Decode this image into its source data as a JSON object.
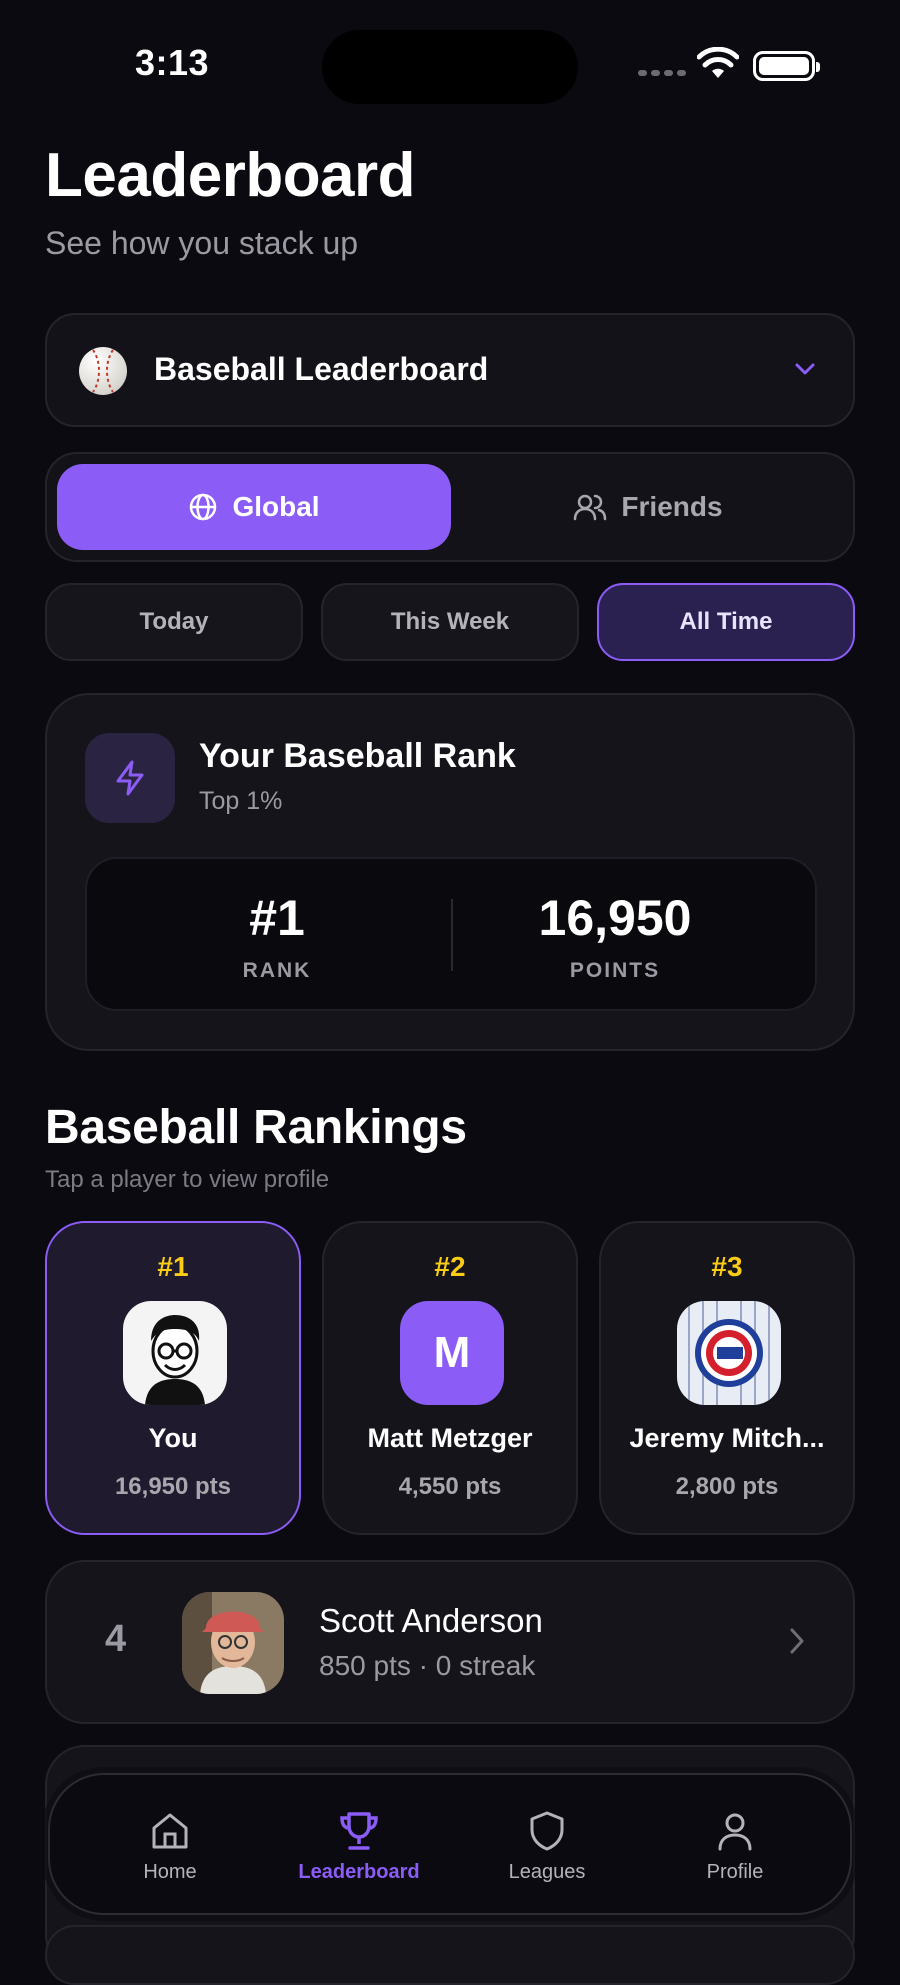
{
  "status_bar": {
    "time": "3:13"
  },
  "header": {
    "title": "Leaderboard",
    "subtitle": "See how you stack up"
  },
  "selector": {
    "label": "Baseball Leaderboard"
  },
  "scope": {
    "global": "Global",
    "friends": "Friends",
    "selected": "Global"
  },
  "periods": {
    "today": "Today",
    "week": "This Week",
    "all": "All Time",
    "selected": "All Time"
  },
  "rank_card": {
    "title": "Your Baseball Rank",
    "subtitle": "Top 1%",
    "rank_value": "#1",
    "rank_label": "RANK",
    "points_value": "16,950",
    "points_label": "POINTS"
  },
  "rankings": {
    "title": "Baseball Rankings",
    "subtitle": "Tap a player to view profile",
    "podium": [
      {
        "rank": "#1",
        "name": "You",
        "points": "16,950 pts"
      },
      {
        "rank": "#2",
        "name": "Matt Metzger",
        "initial": "M",
        "points": "4,550 pts"
      },
      {
        "rank": "#3",
        "name": "Jeremy Mitch...",
        "points": "2,800 pts"
      }
    ],
    "list": [
      {
        "rank": "4",
        "name": "Scott Anderson",
        "meta": "850 pts · 0 streak"
      }
    ]
  },
  "tabbar": {
    "home": "Home",
    "leaderboard": "Leaderboard",
    "leagues": "Leagues",
    "profile": "Profile",
    "active": "Leaderboard"
  },
  "colors": {
    "accent": "#8b5cf6",
    "gold": "#facc15",
    "background": "#0b0a10"
  }
}
